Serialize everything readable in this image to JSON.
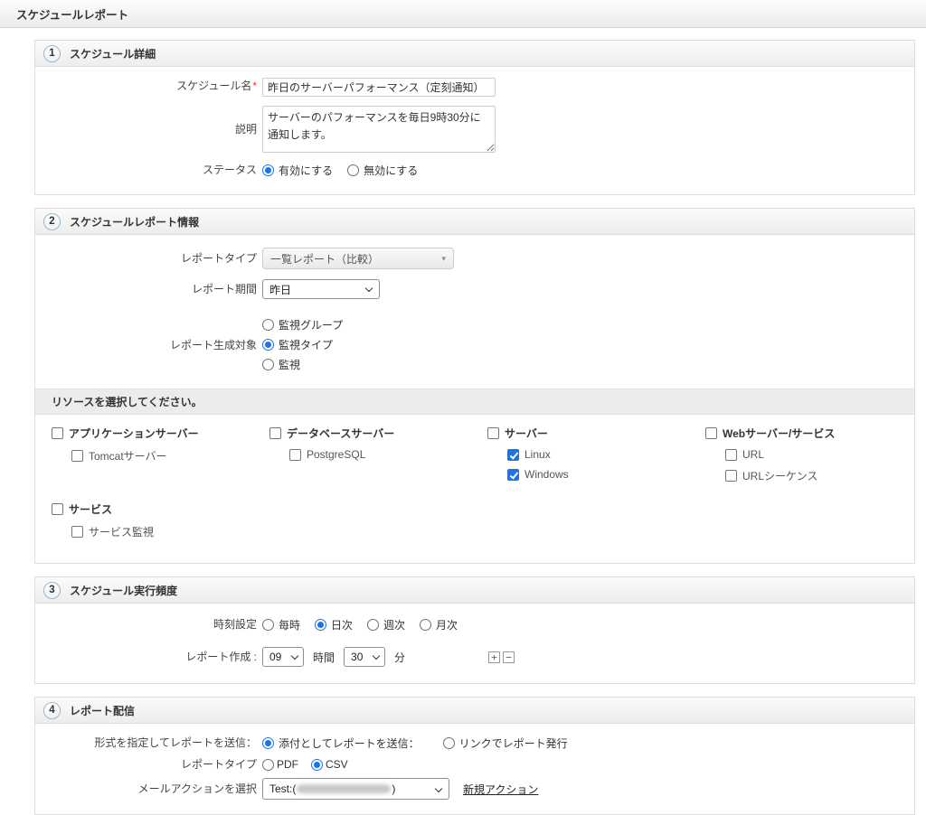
{
  "colors": {
    "accent_blue": "#1a73e8",
    "required_red": "#e53935"
  },
  "page": {
    "title": "スケジュールレポート"
  },
  "section1": {
    "number": "1",
    "title": "スケジュール詳細",
    "schedule_name": {
      "label": "スケジュール名",
      "required_mark": "*",
      "value": "昨日のサーバーパフォーマンス（定刻通知）"
    },
    "description": {
      "label": "説明",
      "value": "サーバーのパフォーマンスを毎日9時30分に通知します。"
    },
    "status": {
      "label": "ステータス",
      "options": [
        {
          "label": "有効にする",
          "selected": true
        },
        {
          "label": "無効にする",
          "selected": false
        }
      ]
    }
  },
  "section2": {
    "number": "2",
    "title": "スケジュールレポート情報",
    "report_type": {
      "label": "レポートタイプ",
      "value": "一覧レポート（比較）",
      "arrow_icon": "▾"
    },
    "report_period": {
      "label": "レポート期間",
      "value": "昨日"
    },
    "target": {
      "label": "レポート生成対象",
      "options": [
        {
          "label": "監視グループ",
          "selected": false
        },
        {
          "label": "監視タイプ",
          "selected": true
        },
        {
          "label": "監視",
          "selected": false
        }
      ]
    },
    "resources": {
      "header": "リソースを選択してください。",
      "groups": [
        {
          "label": "アプリケーションサーバー",
          "checked": false,
          "children": [
            {
              "label": "Tomcatサーバー",
              "checked": false
            }
          ]
        },
        {
          "label": "データベースサーバー",
          "checked": false,
          "children": [
            {
              "label": "PostgreSQL",
              "checked": false
            }
          ]
        },
        {
          "label": "サーバー",
          "checked": false,
          "children": [
            {
              "label": "Linux",
              "checked": true
            },
            {
              "label": "Windows",
              "checked": true
            }
          ]
        },
        {
          "label": "Webサーバー/サービス",
          "checked": false,
          "children": [
            {
              "label": "URL",
              "checked": false
            },
            {
              "label": "URLシーケンス",
              "checked": false
            }
          ]
        },
        {
          "label": "サービス",
          "checked": false,
          "children": [
            {
              "label": "サービス監視",
              "checked": false
            }
          ]
        }
      ]
    }
  },
  "section3": {
    "number": "3",
    "title": "スケジュール実行頻度",
    "time_setting": {
      "label": "時刻設定",
      "options": [
        {
          "label": "毎時",
          "selected": false
        },
        {
          "label": "日次",
          "selected": true
        },
        {
          "label": "週次",
          "selected": false
        },
        {
          "label": "月次",
          "selected": false
        }
      ]
    },
    "report_generation": {
      "label": "レポート作成 :",
      "hour_value": "09",
      "hour_unit": "時間",
      "minute_value": "30",
      "minute_unit": "分",
      "add_icon": "+",
      "remove_icon": "−"
    }
  },
  "section4": {
    "number": "4",
    "title": "レポート配信",
    "format_row": {
      "label": "形式を指定してレポートを送信：",
      "options": [
        {
          "label": "添付としてレポートを送信：",
          "selected": true
        },
        {
          "label": "リンクでレポート発行",
          "selected": false
        }
      ]
    },
    "report_type_row": {
      "label": "レポートタイプ",
      "options": [
        {
          "label": "PDF",
          "selected": false
        },
        {
          "label": "CSV",
          "selected": true
        }
      ]
    },
    "mail_action": {
      "label": "メールアクションを選択",
      "value_prefix": "Test:(",
      "value_suffix": ")",
      "value_redacted": true,
      "new_action_label": "新規アクション"
    }
  }
}
